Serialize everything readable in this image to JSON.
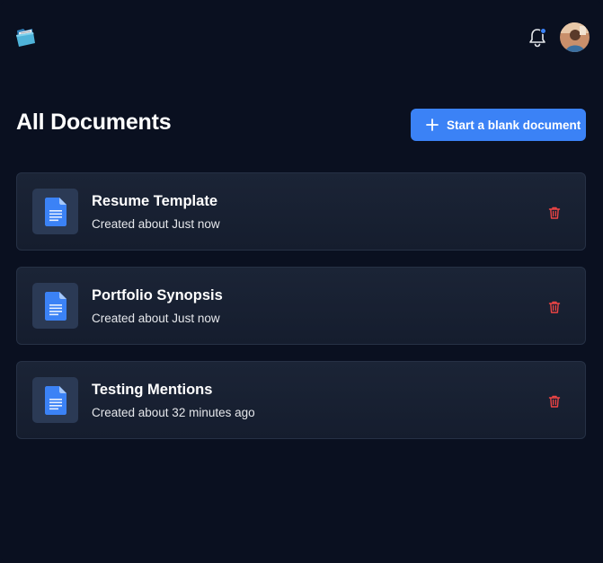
{
  "header": {
    "logo_icon": "folder-icon",
    "notifications_icon": "bell-icon",
    "avatar_icon": "user-avatar"
  },
  "main": {
    "title": "All Documents",
    "new_button_label": "Start a blank document",
    "new_button_icon": "plus-icon"
  },
  "documents": [
    {
      "name": "Resume Template",
      "created": "Created about Just now"
    },
    {
      "name": "Portfolio Synopsis",
      "created": "Created about Just now"
    },
    {
      "name": "Testing Mentions",
      "created": "Created about 32 minutes ago"
    }
  ],
  "colors": {
    "background": "#0a1020",
    "accent": "#3b82f6",
    "delete": "#ef4444",
    "card": "#1b2436",
    "doc_icon": "#3b82f6"
  }
}
